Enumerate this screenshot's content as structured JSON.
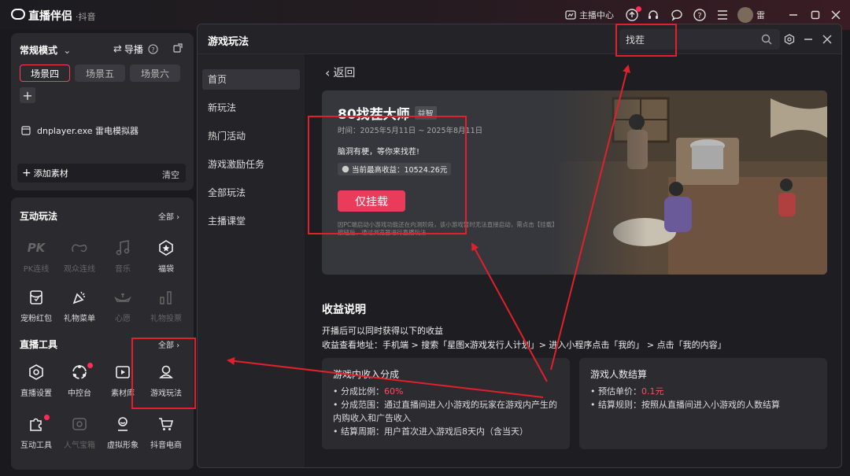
{
  "app": {
    "title": "直播伴侣",
    "subtitle": "·抖音",
    "anchor_center": "主播中心",
    "user_name": "雷"
  },
  "scene_panel": {
    "mode": "常规模式",
    "guide": "导播",
    "tabs": [
      "场景四",
      "场景五",
      "场景六"
    ],
    "active_tab": 0,
    "source": "dnplayer.exe 雷电模拟器",
    "add_material": "添加素材",
    "clear": "清空"
  },
  "interactive": {
    "title": "互动玩法",
    "all": "全部",
    "items": [
      {
        "label": "PK连线",
        "icon": "pk-icon",
        "dim": true
      },
      {
        "label": "观众连线",
        "icon": "audience-link-icon",
        "dim": true
      },
      {
        "label": "音乐",
        "icon": "music-icon",
        "dim": true
      },
      {
        "label": "福袋",
        "icon": "lucky-bag-icon",
        "dim": false
      },
      {
        "label": "宠粉红包",
        "icon": "red-packet-icon",
        "dim": false
      },
      {
        "label": "礼物菜单",
        "icon": "gift-menu-icon",
        "dim": false
      },
      {
        "label": "心愿",
        "icon": "wish-icon",
        "dim": true
      },
      {
        "label": "礼物投票",
        "icon": "gift-vote-icon",
        "dim": true
      }
    ]
  },
  "live_tools": {
    "title": "直播工具",
    "all": "全部",
    "items": [
      {
        "label": "直播设置",
        "icon": "settings-icon",
        "dim": false
      },
      {
        "label": "中控台",
        "icon": "console-icon",
        "dim": false
      },
      {
        "label": "素材库",
        "icon": "material-library-icon",
        "dim": false
      },
      {
        "label": "游戏玩法",
        "icon": "game-play-icon",
        "dim": false
      },
      {
        "label": "互动工具",
        "icon": "puzzle-icon",
        "dim": false
      },
      {
        "label": "人气宝箱",
        "icon": "treasure-box-icon",
        "dim": true
      },
      {
        "label": "虚拟形象",
        "icon": "avatar-figure-icon",
        "dim": false
      },
      {
        "label": "抖音电商",
        "icon": "cart-icon",
        "dim": false
      }
    ]
  },
  "dialog": {
    "title": "游戏玩法",
    "search_value": "找茬",
    "nav": [
      "首页",
      "新玩法",
      "热门活动",
      "游戏激励任务",
      "全部玩法",
      "主播课堂"
    ],
    "active_nav": 0,
    "back": "返回",
    "game": {
      "name": "80找茬大师",
      "tag": "益智",
      "time": "时间：2025年5月11日 ~ 2025年8月11日",
      "slogan": "脑洞有梗，等你来找茬!",
      "max_income_label": "当前最高收益：",
      "max_income_value": "10524.26元",
      "mount_button": "仅挂载",
      "note": "因PC端启动小游戏功能还在内测阶段，该小游戏暂时无法直接启动，需点击【挂载】按钮后，通过浏览器进行直播玩法"
    },
    "income": {
      "title": "收益说明",
      "line1": "开播后可以同时获得以下的收益",
      "line2": "收益查看地址：手机端 > 搜索「星图x游戏发行人计划」> 进入小程序点击「我的」 > 点击「我的内容」",
      "card1": {
        "title": "游戏内收入分成",
        "ratio_label": "• 分成比例：",
        "ratio_value": "60%",
        "range": "• 分成范围：通过直播间进入小游戏的玩家在游戏内产生的内购收入和广告收入",
        "cycle": "• 结算周期：用户首次进入游戏后8天内（含当天）"
      },
      "card2": {
        "title": "游戏人数结算",
        "price_label": "• 预估单价：",
        "price_value": "0.1元",
        "rule": "• 结算规则：按照从直播间进入小游戏的人数结算"
      }
    }
  },
  "colors": {
    "accent": "#ea3b5b",
    "annotation": "#e0212c"
  }
}
